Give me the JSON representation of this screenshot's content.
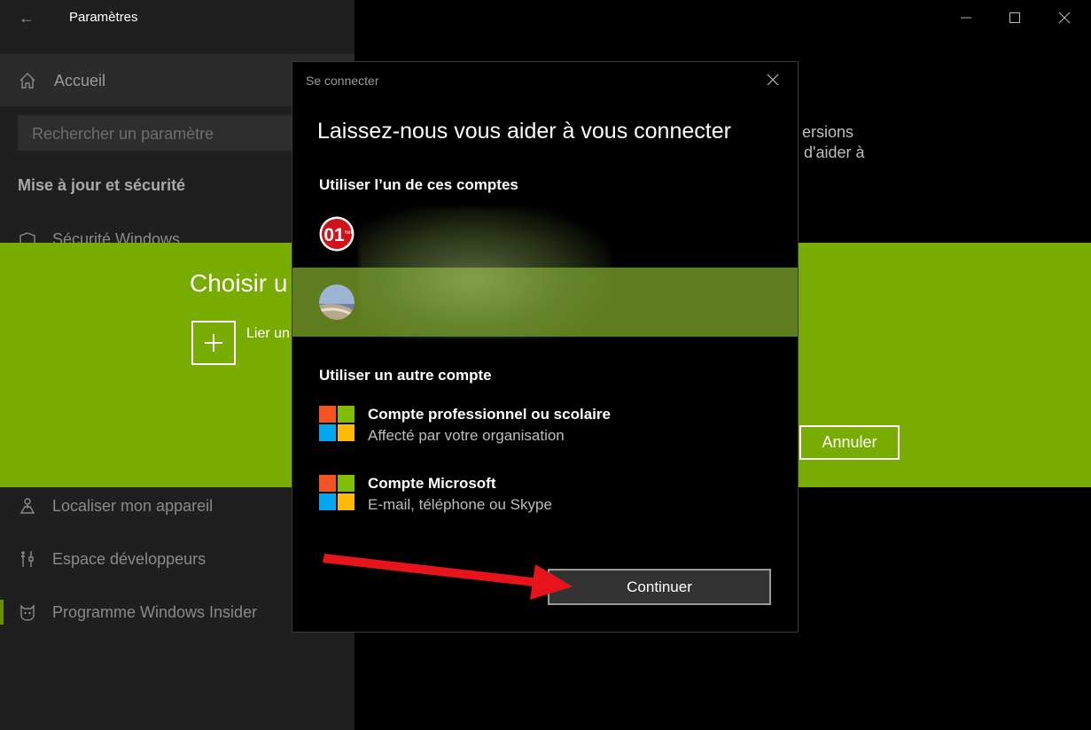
{
  "window": {
    "title": "Paramètres",
    "controls": {
      "minimize_icon": "minimize-icon",
      "maximize_icon": "maximize-icon",
      "close_icon": "close-icon"
    }
  },
  "sidebar": {
    "home_label": "Accueil",
    "search_placeholder": "Rechercher un paramètre",
    "section_title": "Mise à jour et sécurité",
    "items": [
      {
        "label": "Sécurité Windows",
        "icon": "shield-icon"
      },
      {
        "label": "Localiser mon appareil",
        "icon": "locate-icon"
      },
      {
        "label": "Espace développeurs",
        "icon": "developer-tools-icon"
      },
      {
        "label": "Programme Windows Insider",
        "icon": "insider-cat-icon"
      }
    ]
  },
  "right_pane": {
    "text_line1": "ersions",
    "text_line2": "d'aider à"
  },
  "green_panel": {
    "title": "Choisir u",
    "link_label": "Lier un",
    "cancel_label": "Annuler",
    "color": "#78ac00"
  },
  "dialog": {
    "title": "Se connecter",
    "headline": "Laissez-nous vous aider à vous connecter",
    "use_account_title": "Utiliser l’un de ces comptes",
    "accounts": [
      {
        "avatar": "01net-logo"
      },
      {
        "avatar": "user-photo",
        "selected": true
      }
    ],
    "other_account_title": "Utiliser un autre compte",
    "options": [
      {
        "title": "Compte professionnel ou scolaire",
        "subtitle": "Affecté par votre organisation",
        "icon": "microsoft-logo-icon"
      },
      {
        "title": "Compte Microsoft",
        "subtitle": "E-mail, téléphone ou Skype",
        "icon": "microsoft-logo-icon"
      }
    ],
    "continue_label": "Continuer",
    "selected_color": "#5d7d1e"
  },
  "annotation": {
    "arrow_color": "#e8141b"
  }
}
